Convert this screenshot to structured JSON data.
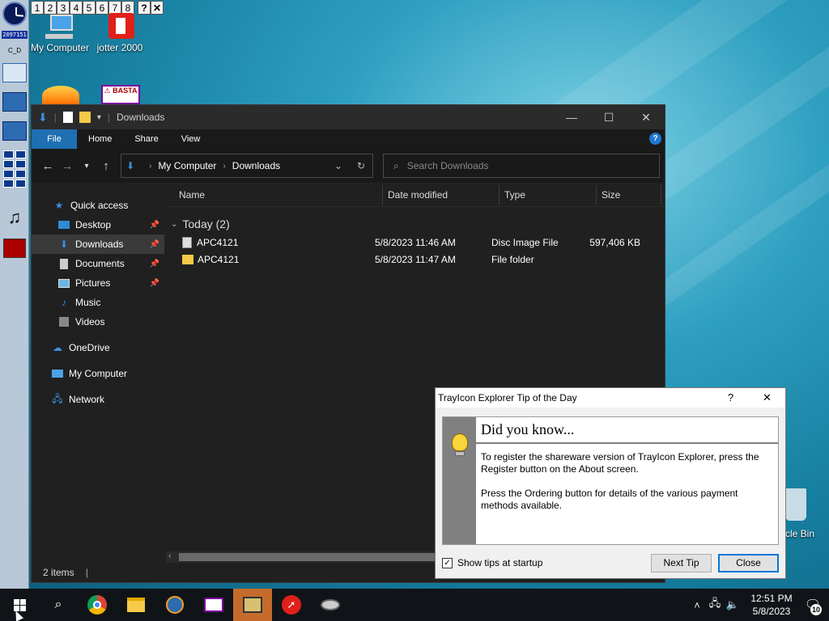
{
  "top_tabs": [
    "1",
    "2",
    "3",
    "4",
    "5",
    "6",
    "7",
    "8"
  ],
  "top_tabs_extra": {
    "help": "?",
    "close": "✕"
  },
  "dock": {
    "counter": "2097151"
  },
  "desktop_icons": [
    {
      "label": "My Computer"
    },
    {
      "label": "jotter 2000"
    },
    {
      "label": "cle Bin"
    }
  ],
  "explorer": {
    "title": "Downloads",
    "ribbon_tabs": [
      "File",
      "Home",
      "Share",
      "View"
    ],
    "help": "?",
    "address": {
      "root": "My Computer",
      "current": "Downloads"
    },
    "search_placeholder": "Search Downloads",
    "nav": {
      "quick_access": "Quick access",
      "items": [
        "Desktop",
        "Downloads",
        "Documents",
        "Pictures",
        "Music",
        "Videos"
      ],
      "onedrive": "OneDrive",
      "my_computer": "My Computer",
      "network": "Network"
    },
    "columns": [
      "Name",
      "Date modified",
      "Type",
      "Size"
    ],
    "group": "Today (2)",
    "files": [
      {
        "name": "APC4121",
        "date": "5/8/2023 11:46 AM",
        "type": "Disc Image File",
        "size": "597,406 KB"
      },
      {
        "name": "APC4121",
        "date": "5/8/2023 11:47 AM",
        "type": "File folder",
        "size": ""
      }
    ],
    "status": "2 items"
  },
  "dialog": {
    "title": "TrayIcon Explorer Tip of the Day",
    "help": "?",
    "close": "✕",
    "heading": "Did you know...",
    "para1": "To register the shareware version of TrayIcon Explorer, press the Register button on the About screen.",
    "para2": "Press the Ordering button for details of the various payment methods available.",
    "checkbox_label": "Show tips at startup",
    "checkbox_checked": true,
    "next_tip": "Next Tip",
    "close_btn": "Close"
  },
  "taskbar": {
    "time": "12:51 PM",
    "date": "5/8/2023",
    "notifications": "10"
  }
}
